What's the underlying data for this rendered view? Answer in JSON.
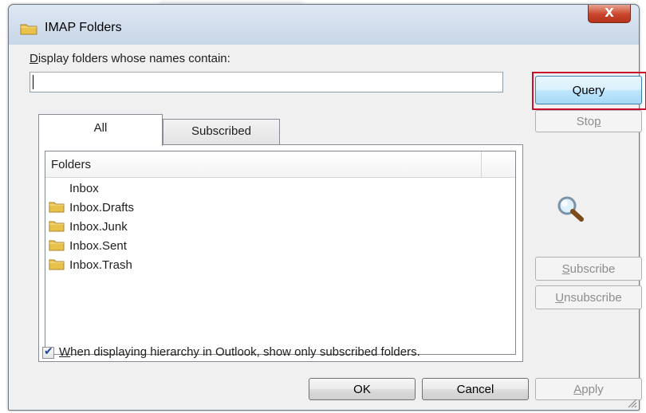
{
  "window": {
    "title": "IMAP Folders",
    "close_glyph": "X"
  },
  "search": {
    "label_prefix": "D",
    "label_rest": "isplay folders whose names contain:",
    "value": ""
  },
  "buttons": {
    "query": "Query",
    "stop_before": "Sto",
    "stop_mnemonic": "p",
    "subscribe_mnemonic": "S",
    "subscribe_rest": "ubscribe",
    "unsubscribe_mnemonic": "U",
    "unsubscribe_rest": "nsubscribe",
    "ok": "OK",
    "cancel": "Cancel",
    "apply_mnemonic": "A",
    "apply_rest": "pply"
  },
  "tabs": [
    {
      "label": "All",
      "active": true
    },
    {
      "label": "Subscribed",
      "active": false
    }
  ],
  "folder_list": {
    "column_header": "Folders",
    "items": [
      {
        "name": "Inbox",
        "icon": "none"
      },
      {
        "name": "Inbox.Drafts",
        "icon": "folder-icon"
      },
      {
        "name": "Inbox.Junk",
        "icon": "folder-icon"
      },
      {
        "name": "Inbox.Sent",
        "icon": "folder-icon"
      },
      {
        "name": "Inbox.Trash",
        "icon": "folder-icon"
      }
    ]
  },
  "hierarchy_option": {
    "checked": true,
    "mnemonic": "W",
    "label_rest": "hen displaying hierarchy in Outlook, show only subscribed folders."
  },
  "colors": {
    "highlight": "#c8102e",
    "folder": "#e8c24a"
  },
  "icons": {
    "title": "folder-icon",
    "search": "magnifier-icon",
    "resize": "resize-grip-icon"
  }
}
